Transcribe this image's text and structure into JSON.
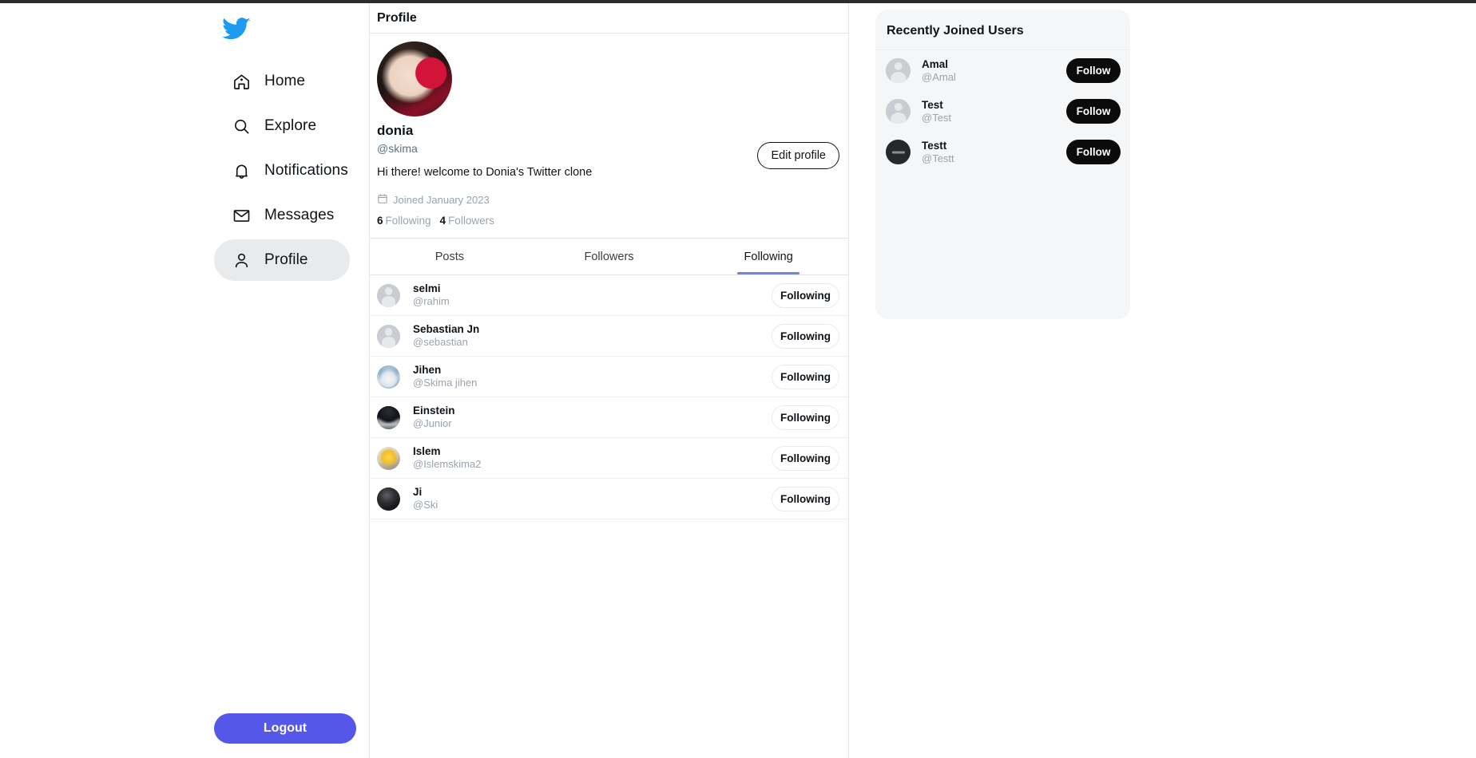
{
  "brand": {
    "logo_icon": "twitter-bird-icon",
    "logo_color": "#1d9bf0",
    "accent_color": "#5457e8",
    "tab_underline_color": "#6d86d8"
  },
  "sidebar": {
    "items": [
      {
        "label": "Home",
        "icon": "home-icon",
        "active": false
      },
      {
        "label": "Explore",
        "icon": "search-icon",
        "active": false
      },
      {
        "label": "Notifications",
        "icon": "bell-icon",
        "active": false
      },
      {
        "label": "Messages",
        "icon": "envelope-icon",
        "active": false
      },
      {
        "label": "Profile",
        "icon": "person-icon",
        "active": true
      }
    ],
    "logout_label": "Logout"
  },
  "main": {
    "header_title": "Profile",
    "profile": {
      "avatar_icon": "profile-photo",
      "display_name": "donia",
      "handle": "@skima",
      "bio": "Hi there! welcome to Donia's Twitter clone",
      "joined_icon": "calendar-icon",
      "joined_text": "Joined January 2023",
      "following_count": "6",
      "following_label": "Following",
      "followers_count": "4",
      "followers_label": "Followers",
      "edit_button_label": "Edit profile"
    },
    "tabs": [
      {
        "label": "Posts",
        "active": false
      },
      {
        "label": "Followers",
        "active": false
      },
      {
        "label": "Following",
        "active": true
      }
    ],
    "following_list": [
      {
        "name": "selmi",
        "handle": "@rahim",
        "button_label": "Following",
        "avatar": "placeholder"
      },
      {
        "name": "Sebastian Jn",
        "handle": "@sebastian",
        "button_label": "Following",
        "avatar": "placeholder"
      },
      {
        "name": "Jihen",
        "handle": "@Skima jihen",
        "button_label": "Following",
        "avatar": "jihen"
      },
      {
        "name": "Einstein",
        "handle": "@Junior",
        "button_label": "Following",
        "avatar": "einstein"
      },
      {
        "name": "Islem",
        "handle": "@Islemskima2",
        "button_label": "Following",
        "avatar": "islem"
      },
      {
        "name": "Ji",
        "handle": "@Ski",
        "button_label": "Following",
        "avatar": "ji"
      }
    ]
  },
  "right_sidebar": {
    "card_title": "Recently Joined Users",
    "users": [
      {
        "name": "Amal",
        "handle": "@Amal",
        "button_label": "Follow",
        "avatar": "placeholder"
      },
      {
        "name": "Test",
        "handle": "@Test",
        "button_label": "Follow",
        "avatar": "placeholder"
      },
      {
        "name": "Testt",
        "handle": "@Testt",
        "button_label": "Follow",
        "avatar": "testt"
      }
    ]
  }
}
